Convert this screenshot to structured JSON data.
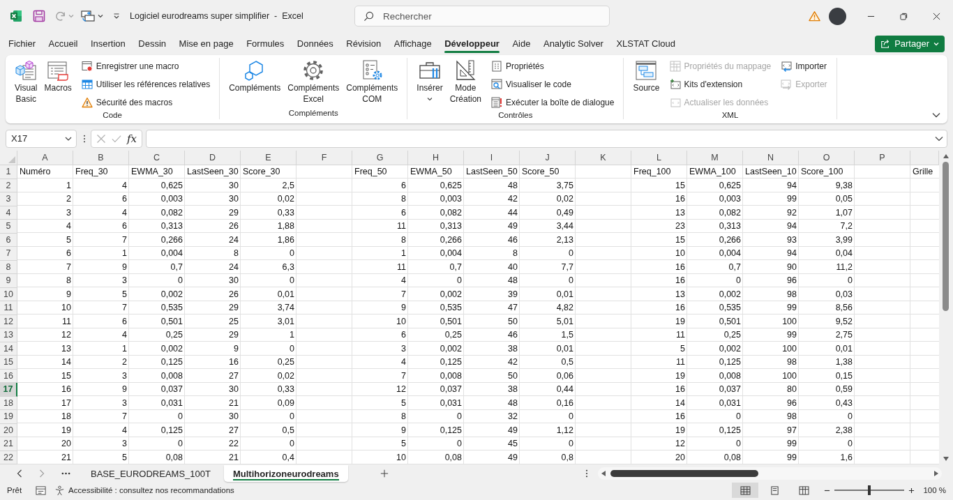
{
  "title_bar": {
    "title": "Logiciel eurodreams super simplifier  -  Excel",
    "search_placeholder": "Rechercher"
  },
  "menu_tabs": [
    {
      "label": "Fichier",
      "selected": false
    },
    {
      "label": "Accueil",
      "selected": false
    },
    {
      "label": "Insertion",
      "selected": false
    },
    {
      "label": "Dessin",
      "selected": false
    },
    {
      "label": "Mise en page",
      "selected": false
    },
    {
      "label": "Formules",
      "selected": false
    },
    {
      "label": "Données",
      "selected": false
    },
    {
      "label": "Révision",
      "selected": false
    },
    {
      "label": "Affichage",
      "selected": false
    },
    {
      "label": "Développeur",
      "selected": true
    },
    {
      "label": "Aide",
      "selected": false
    },
    {
      "label": "Analytic Solver",
      "selected": false
    },
    {
      "label": "XLSTAT Cloud",
      "selected": false
    }
  ],
  "share_button": {
    "label": "Partager"
  },
  "ribbon": {
    "groups": [
      {
        "label": "Code",
        "large_buttons": [
          {
            "label": "Visual Basic",
            "dropdown": false
          },
          {
            "label": "Macros",
            "dropdown": false
          }
        ],
        "small_columns": [
          [
            {
              "label": "Enregistrer une macro",
              "disabled": false
            },
            {
              "label": "Utiliser les références relatives",
              "disabled": false
            },
            {
              "label": "Sécurité des macros",
              "disabled": false
            }
          ]
        ]
      },
      {
        "label": "Compléments",
        "large_buttons": [
          {
            "label": "Compléments",
            "dropdown": false
          },
          {
            "label": "Compléments Excel",
            "dropdown": false
          },
          {
            "label": "Compléments COM",
            "dropdown": false
          }
        ]
      },
      {
        "label": "Contrôles",
        "large_buttons": [
          {
            "label": "Insérer",
            "dropdown": true
          },
          {
            "label": "Mode Création",
            "dropdown": false
          }
        ],
        "small_columns": [
          [
            {
              "label": "Propriétés",
              "disabled": false
            },
            {
              "label": "Visualiser le code",
              "disabled": false
            },
            {
              "label": "Exécuter la boîte de dialogue",
              "disabled": false
            }
          ]
        ]
      },
      {
        "label": "XML",
        "large_buttons": [
          {
            "label": "Source",
            "dropdown": false
          }
        ],
        "small_columns": [
          [
            {
              "label": "Propriétés du mappage",
              "disabled": true
            },
            {
              "label": "Kits d'extension",
              "disabled": false
            },
            {
              "label": "Actualiser les données",
              "disabled": true
            }
          ],
          [
            {
              "label": "Importer",
              "disabled": false
            },
            {
              "label": "Exporter",
              "disabled": true
            }
          ]
        ]
      }
    ]
  },
  "formula_bar": {
    "name_box": "X17",
    "function_label": "fx"
  },
  "sheet": {
    "column_letters": [
      "A",
      "B",
      "C",
      "D",
      "E",
      "F",
      "G",
      "H",
      "I",
      "J",
      "K",
      "L",
      "M",
      "N",
      "O",
      "P"
    ],
    "header_row": {
      "number": "1",
      "selected": false,
      "cells": [
        "Numéro",
        "Freq_30",
        "EWMA_30",
        "LastSeen_30",
        "Score_30",
        null,
        "Freq_50",
        "EWMA_50",
        "LastSeen_50",
        "Score_50",
        null,
        "Freq_100",
        "EWMA_100",
        "LastSeen_10",
        "Score_100",
        null,
        "Grille"
      ]
    },
    "rows": [
      {
        "number": "2",
        "selected": false,
        "cells": [
          "1",
          "4",
          "0,625",
          "30",
          "2,5",
          null,
          "6",
          "0,625",
          "48",
          "3,75",
          null,
          "15",
          "0,625",
          "94",
          "9,38",
          null
        ]
      },
      {
        "number": "3",
        "selected": false,
        "cells": [
          "2",
          "6",
          "0,003",
          "30",
          "0,02",
          null,
          "8",
          "0,003",
          "42",
          "0,02",
          null,
          "16",
          "0,003",
          "99",
          "0,05",
          null
        ]
      },
      {
        "number": "4",
        "selected": false,
        "cells": [
          "3",
          "4",
          "0,082",
          "29",
          "0,33",
          null,
          "6",
          "0,082",
          "44",
          "0,49",
          null,
          "13",
          "0,082",
          "92",
          "1,07",
          null
        ]
      },
      {
        "number": "5",
        "selected": false,
        "cells": [
          "4",
          "6",
          "0,313",
          "26",
          "1,88",
          null,
          "11",
          "0,313",
          "49",
          "3,44",
          null,
          "23",
          "0,313",
          "94",
          "7,2",
          null
        ]
      },
      {
        "number": "6",
        "selected": false,
        "cells": [
          "5",
          "7",
          "0,266",
          "24",
          "1,86",
          null,
          "8",
          "0,266",
          "46",
          "2,13",
          null,
          "15",
          "0,266",
          "93",
          "3,99",
          null
        ]
      },
      {
        "number": "7",
        "selected": false,
        "cells": [
          "6",
          "1",
          "0,004",
          "8",
          "0",
          null,
          "1",
          "0,004",
          "8",
          "0",
          null,
          "10",
          "0,004",
          "94",
          "0,04",
          null
        ]
      },
      {
        "number": "8",
        "selected": false,
        "cells": [
          "7",
          "9",
          "0,7",
          "24",
          "6,3",
          null,
          "11",
          "0,7",
          "40",
          "7,7",
          null,
          "16",
          "0,7",
          "90",
          "11,2",
          null
        ]
      },
      {
        "number": "9",
        "selected": false,
        "cells": [
          "8",
          "3",
          "0",
          "30",
          "0",
          null,
          "4",
          "0",
          "48",
          "0",
          null,
          "16",
          "0",
          "96",
          "0",
          null
        ]
      },
      {
        "number": "10",
        "selected": false,
        "cells": [
          "9",
          "5",
          "0,002",
          "26",
          "0,01",
          null,
          "7",
          "0,002",
          "39",
          "0,01",
          null,
          "13",
          "0,002",
          "98",
          "0,03",
          null
        ]
      },
      {
        "number": "11",
        "selected": false,
        "cells": [
          "10",
          "7",
          "0,535",
          "29",
          "3,74",
          null,
          "9",
          "0,535",
          "47",
          "4,82",
          null,
          "16",
          "0,535",
          "99",
          "8,56",
          null
        ]
      },
      {
        "number": "12",
        "selected": false,
        "cells": [
          "11",
          "6",
          "0,501",
          "25",
          "3,01",
          null,
          "10",
          "0,501",
          "50",
          "5,01",
          null,
          "19",
          "0,501",
          "100",
          "9,52",
          null
        ]
      },
      {
        "number": "13",
        "selected": false,
        "cells": [
          "12",
          "4",
          "0,25",
          "29",
          "1",
          null,
          "6",
          "0,25",
          "46",
          "1,5",
          null,
          "11",
          "0,25",
          "99",
          "2,75",
          null
        ]
      },
      {
        "number": "14",
        "selected": false,
        "cells": [
          "13",
          "1",
          "0,002",
          "9",
          "0",
          null,
          "3",
          "0,002",
          "38",
          "0,01",
          null,
          "5",
          "0,002",
          "100",
          "0,01",
          null
        ]
      },
      {
        "number": "15",
        "selected": false,
        "cells": [
          "14",
          "2",
          "0,125",
          "16",
          "0,25",
          null,
          "4",
          "0,125",
          "42",
          "0,5",
          null,
          "11",
          "0,125",
          "98",
          "1,38",
          null
        ]
      },
      {
        "number": "16",
        "selected": false,
        "cells": [
          "15",
          "3",
          "0,008",
          "27",
          "0,02",
          null,
          "7",
          "0,008",
          "50",
          "0,06",
          null,
          "19",
          "0,008",
          "100",
          "0,15",
          null
        ]
      },
      {
        "number": "17",
        "selected": true,
        "cells": [
          "16",
          "9",
          "0,037",
          "30",
          "0,33",
          null,
          "12",
          "0,037",
          "38",
          "0,44",
          null,
          "16",
          "0,037",
          "80",
          "0,59",
          null
        ]
      },
      {
        "number": "18",
        "selected": false,
        "cells": [
          "17",
          "3",
          "0,031",
          "21",
          "0,09",
          null,
          "5",
          "0,031",
          "48",
          "0,16",
          null,
          "14",
          "0,031",
          "96",
          "0,43",
          null
        ]
      },
      {
        "number": "19",
        "selected": false,
        "cells": [
          "18",
          "7",
          "0",
          "30",
          "0",
          null,
          "8",
          "0",
          "32",
          "0",
          null,
          "16",
          "0",
          "98",
          "0",
          null
        ]
      },
      {
        "number": "20",
        "selected": false,
        "cells": [
          "19",
          "4",
          "0,125",
          "27",
          "0,5",
          null,
          "9",
          "0,125",
          "49",
          "1,12",
          null,
          "19",
          "0,125",
          "97",
          "2,38",
          null
        ]
      },
      {
        "number": "21",
        "selected": false,
        "cells": [
          "20",
          "3",
          "0",
          "22",
          "0",
          null,
          "5",
          "0",
          "45",
          "0",
          null,
          "12",
          "0",
          "99",
          "0",
          null
        ]
      },
      {
        "number": "22",
        "selected": false,
        "cells": [
          "21",
          "5",
          "0,08",
          "21",
          "0,4",
          null,
          "10",
          "0,08",
          "49",
          "0,8",
          null,
          "20",
          "0,08",
          "99",
          "1,6",
          null
        ]
      }
    ]
  },
  "sheet_tabs": [
    {
      "label": "BASE_EURODREAMS_100T",
      "selected": false
    },
    {
      "label": "Multihorizoneurodreams",
      "selected": true
    }
  ],
  "status_bar": {
    "mode": "Prêt",
    "accessibility": "Accessibilité : consultez nos recommandations",
    "views": [
      {
        "selected": true
      },
      {
        "selected": false
      },
      {
        "selected": false
      }
    ],
    "zoom_slider": {
      "level": 0.5
    },
    "zoom": "100 %"
  }
}
